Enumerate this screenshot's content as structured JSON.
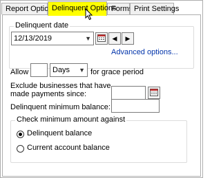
{
  "tabs": [
    {
      "label": "Report Options",
      "active": false
    },
    {
      "label": "Delinquent Options",
      "active": true
    },
    {
      "label": "Forms",
      "active": false
    },
    {
      "label": "Print Settings",
      "active": false
    }
  ],
  "delinquent_date": {
    "legend": "Delinquent date",
    "value": "12/13/2019",
    "advanced_link": "Advanced options..."
  },
  "grace": {
    "allow_label": "Allow",
    "amount_value": "",
    "unit_value": "Days",
    "suffix_label": "for grace period"
  },
  "exclude": {
    "label_line1": "Exclude businesses that have",
    "label_line2": "made payments since:",
    "value": ""
  },
  "min_balance": {
    "label": "Delinquent minimum balance:",
    "value": ""
  },
  "check_min": {
    "legend": "Check minimum amount against",
    "options": [
      {
        "label": "Delinquent balance",
        "checked": true
      },
      {
        "label": "Current account balance",
        "checked": false
      }
    ]
  },
  "colors": {
    "active_tab": "#ffff00",
    "link": "#0033aa"
  }
}
